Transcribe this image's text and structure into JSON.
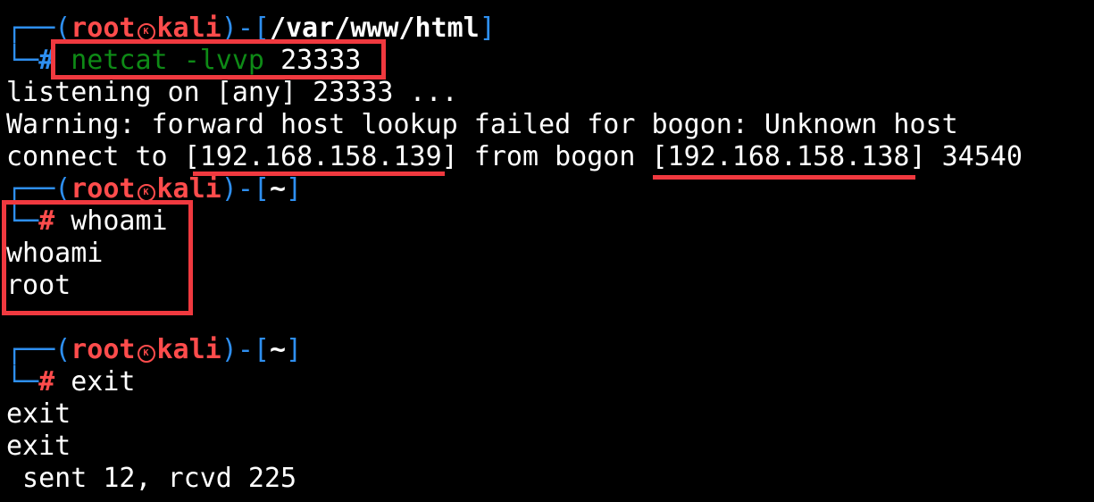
{
  "colors": {
    "background": "#000000",
    "prompt_frame": "#2e8ff0",
    "prompt_user": "#ff4c4c",
    "command_green": "#0e8a16",
    "text": "#ffffff",
    "highlight": "#f0393f"
  },
  "icons": {
    "kali_symbol": "kali-dragon-icon"
  },
  "blocks": [
    {
      "prompt": {
        "corner": "┌──",
        "open": "(",
        "user": "root",
        "host": "kali",
        "close": ")",
        "dash": "-",
        "path_open": "[",
        "path": "/var/www/html",
        "path_close": "]"
      },
      "command": {
        "corner": "└─",
        "hash": "#",
        "cmd": "netcat",
        "flag": "-lvvp",
        "arg": "23333"
      },
      "output": [
        "listening on [any] 23333 ...",
        "Warning: forward host lookup failed for bogon: Unknown host"
      ],
      "connect": {
        "prefix": "connect to ",
        "target_ip": "[192.168.158.139]",
        "mid": " from bogon ",
        "source_ip": "[192.168.158.138]",
        "port": " 34540"
      }
    },
    {
      "prompt": {
        "corner": "┌──",
        "open": "(",
        "user": "root",
        "host": "kali",
        "close": ")",
        "dash": "-",
        "path_open": "[",
        "path": "~",
        "path_close": "]"
      },
      "command": {
        "corner": "└─",
        "hash": "#",
        "cmd": "whoami"
      },
      "output": [
        "whoami",
        "root"
      ]
    },
    {
      "prompt": {
        "corner": "┌──",
        "open": "(",
        "user": "root",
        "host": "kali",
        "close": ")",
        "dash": "-",
        "path_open": "[",
        "path": "~",
        "path_close": "]"
      },
      "command": {
        "corner": "└─",
        "hash": "#",
        "cmd": "exit"
      },
      "output": [
        "exit",
        "exit",
        " sent 12, rcvd 225"
      ]
    }
  ]
}
